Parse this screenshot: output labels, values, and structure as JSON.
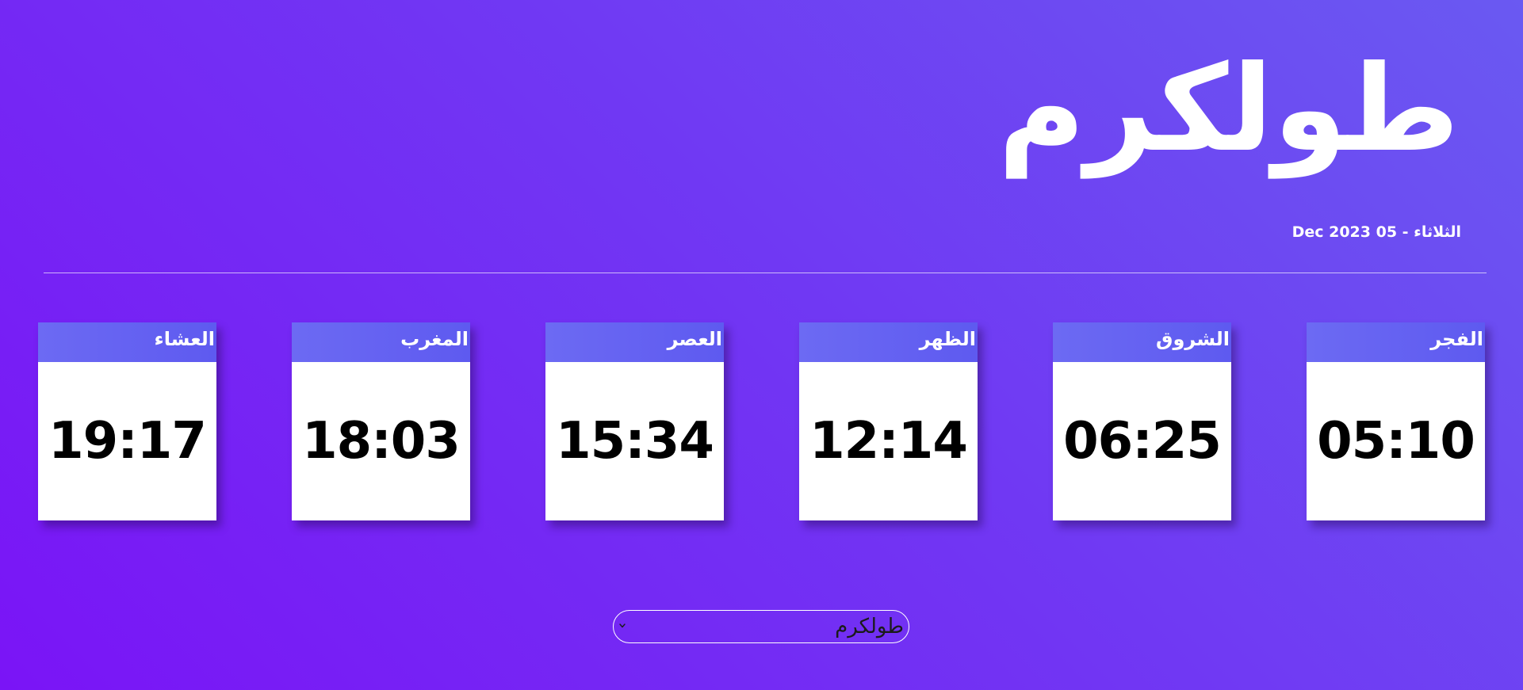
{
  "header": {
    "city": "طولكرم",
    "date": "الثلاثاء - 05 Dec 2023"
  },
  "prayers": [
    {
      "name": "الفجر",
      "time": "05:10"
    },
    {
      "name": "الشروق",
      "time": "06:25"
    },
    {
      "name": "الظهر",
      "time": "12:14"
    },
    {
      "name": "العصر",
      "time": "15:34"
    },
    {
      "name": "المغرب",
      "time": "18:03"
    },
    {
      "name": "العشاء",
      "time": "19:17"
    }
  ],
  "city_select": {
    "selected": "طولكرم",
    "icon": "chevron-down-icon"
  },
  "colors": {
    "background_start": "#7a14f6",
    "background_end": "#6a59f2",
    "card_header": "#6c6af3",
    "card_body": "#ffffff"
  }
}
